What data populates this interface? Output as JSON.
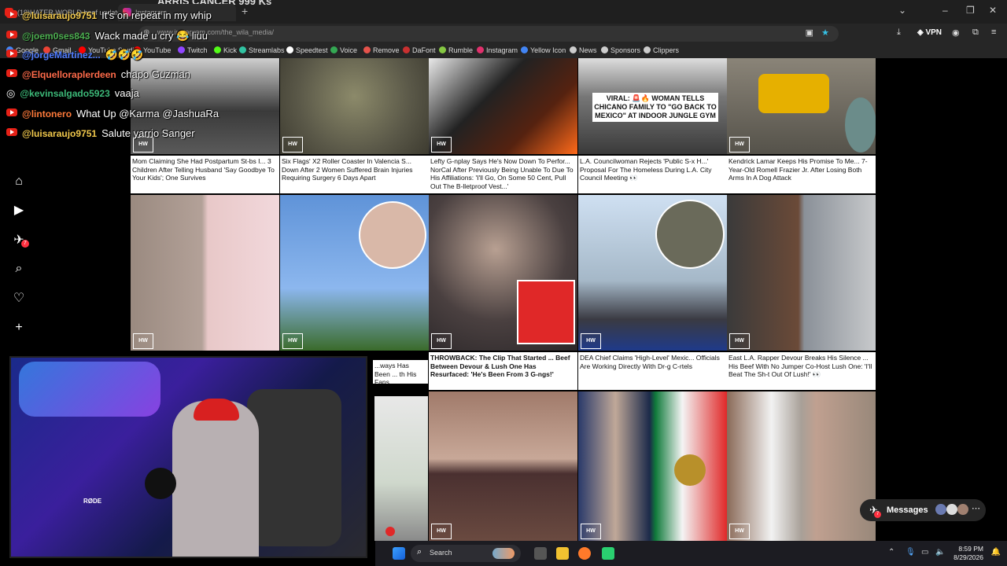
{
  "browser": {
    "tabs": [
      {
        "label": "(19)HATER WORLD beef update Wi..."
      },
      {
        "label": "Instagram"
      }
    ],
    "top_text": "ARRIS CANCER 999 Ks",
    "url": "www.instagram.com/the_wila_media/",
    "vpn_label": "VPN",
    "bookmarks": [
      {
        "label": "Google",
        "color": "#4285f4"
      },
      {
        "label": "Gmail",
        "color": "#ea4335"
      },
      {
        "label": "YouTube Studio",
        "color": "#ff0000"
      },
      {
        "label": "YouTube",
        "color": "#ff0000"
      },
      {
        "label": "Twitch",
        "color": "#9146ff"
      },
      {
        "label": "Kick",
        "color": "#53fc18"
      },
      {
        "label": "Streamlabs",
        "color": "#31c3a2"
      },
      {
        "label": "Speedtest",
        "color": "#ffffff"
      },
      {
        "label": "Voice",
        "color": "#34a853"
      },
      {
        "label": "Remove",
        "color": "#e5534b"
      },
      {
        "label": "DaFont",
        "color": "#c93030"
      },
      {
        "label": "Rumble",
        "color": "#85c742"
      },
      {
        "label": "Instagram",
        "color": "#e1306c"
      },
      {
        "label": "Yellow Icon",
        "color": "#4285f4"
      },
      {
        "label": "News",
        "color": "#cccccc"
      },
      {
        "label": "Sponsors",
        "color": "#cccccc"
      },
      {
        "label": "Clippers",
        "color": "#cccccc"
      }
    ]
  },
  "chat": [
    {
      "user": "@luisaraujo9751",
      "msg": "It's on repeat in my whip",
      "color": "#f2c94c",
      "icon": "youtube"
    },
    {
      "user": "@joem0ses843",
      "msg": "Wack made u cry 😂 liuu",
      "color": "#4caf50",
      "icon": "youtube"
    },
    {
      "user": "@jorgeMartinez...",
      "msg": "🤣🤣🤣",
      "color": "#4f7cff",
      "icon": "youtube"
    },
    {
      "user": "@Elquelloraplerdeen",
      "msg": "chapo Guzman",
      "color": "#ff6b4a",
      "icon": "youtube"
    },
    {
      "user": "@kevinsalgado5923",
      "msg": "vaaja",
      "color": "#3cb878",
      "icon": "instagram"
    },
    {
      "user": "@lintonero",
      "msg": "What Up @Karma @JashuaRa",
      "color": "#ff7a3a",
      "icon": "youtube"
    },
    {
      "user": "@luisaraujo9751",
      "msg": "Salute yarrio Sanger",
      "color": "#f2c94c",
      "icon": "youtube"
    }
  ],
  "sidebar": {
    "items": [
      {
        "name": "home-icon",
        "glyph": "⌂"
      },
      {
        "name": "reels-icon",
        "glyph": "▶"
      },
      {
        "name": "messenger-icon",
        "glyph": "✈"
      },
      {
        "name": "search-icon",
        "glyph": "⌕"
      },
      {
        "name": "heart-icon",
        "glyph": "♡"
      },
      {
        "name": "create-icon",
        "glyph": "+"
      }
    ],
    "badge": "7"
  },
  "posts": [
    {
      "caption": "Mom Claiming She Had Postpartum St-bs I... 3 Children After Telling Husband 'Say Goodbye To Your Kids'; One Survives"
    },
    {
      "caption": "Six Flags' X2 Roller Coaster In Valencia S... Down After 2 Women Suffered Brain Injuries Requiring Surgery 6 Days Apart"
    },
    {
      "caption": "Lefty G-nplay Says He's Now Down To Perfor... NorCal After Previously Being Unable To Due To His Affiliations: 'I'll Go, On Some 50 Cent, Pull Out The B-lletproof Vest...'"
    },
    {
      "caption": "L.A. Councilwoman Rejects 'Public S-x H...' Proposal For The Homeless During L.A. City Council Meeting 👀"
    },
    {
      "caption": "Kendrick Lamar Keeps His Promise To Me... 7-Year-Old Romell Frazier Jr. After Losing Both Arms In A Dog Attack"
    },
    {
      "caption": "THROWBACK: The Clip That Started ... Beef Between Devour & Lush One Has Resurfaced: 'He's Been From 3 G-ngs!'"
    },
    {
      "caption": "DEA Chief Claims 'High-Level' Mexic... Officials Are Working Directly With Dr-g C-rtels"
    },
    {
      "caption": "East L.A. Rapper Devour Breaks His Silence ... His Beef With No Jumper Co-Host Lush One: 'I'll Beat The Sh-t Out Of Lush!' 👀"
    },
    {
      "caption": "...ways Has Been ... th His Fans"
    }
  ],
  "viral_overlay": "VIRAL: 🚨🔥 WOMAN TELLS CHICANO FAMILY TO \"GO BACK TO MEXICO\" AT INDOOR JUNGLE GYM",
  "watermark": "HW",
  "webcam": {
    "mic_label": "RØDE"
  },
  "messages": {
    "label": "Messages",
    "badge": "7"
  },
  "taskbar": {
    "search": "Search",
    "time": "8:59 PM",
    "date": "8/29/2026"
  }
}
